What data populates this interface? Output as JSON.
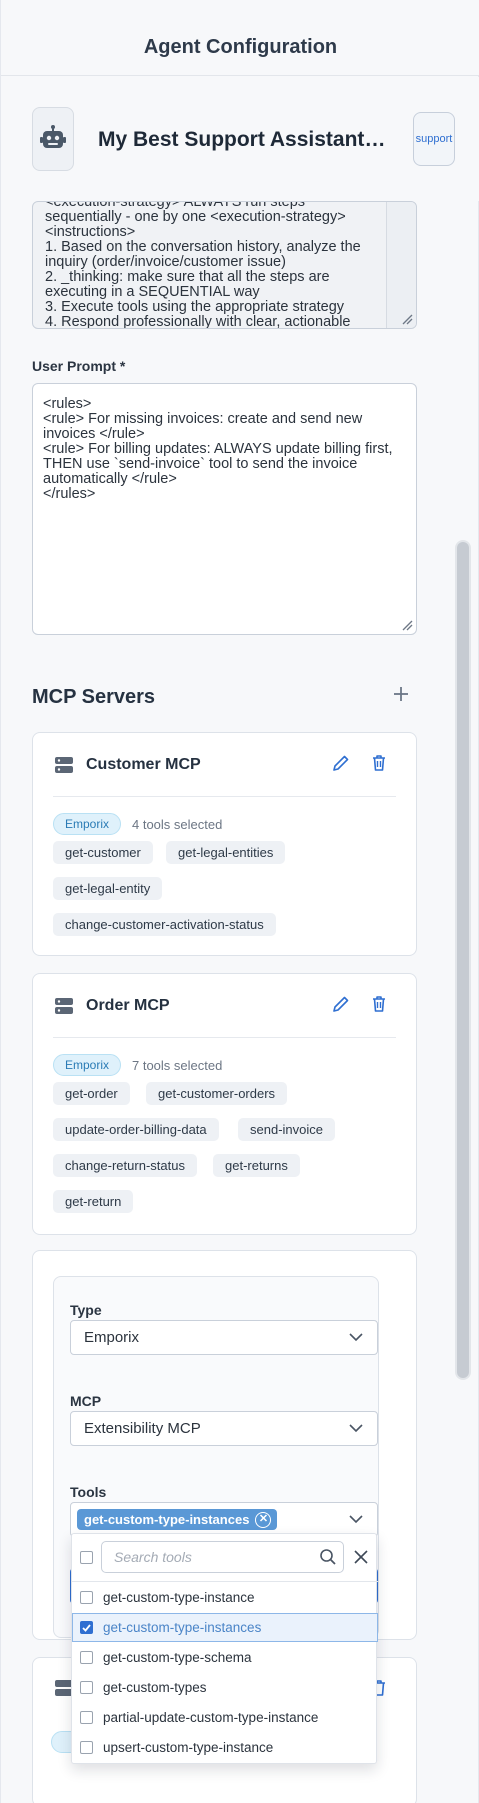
{
  "header": {
    "title": "Agent Configuration"
  },
  "agent": {
    "name": "My Best Support Assistant Co...",
    "support_button": "support",
    "avatar_icon": "robot-icon"
  },
  "system_prompt": {
    "value": "<execution-strategy> ALWAYS run steps sequentially - one by one <execution-strategy>\n<instructions>\n1. Based on the conversation history, analyze the inquiry (order/invoice/customer issue)\n2. _thinking: make sure that all the steps are executing in a SEQUENTIAL way\n3. Execute tools using the appropriate strategy\n4. Respond professionally with clear, actionable"
  },
  "user_prompt": {
    "label": "User Prompt *",
    "value": "<rules>\n<rule> For missing invoices: create and send new invoices </rule>\n<rule> For billing updates: ALWAYS update billing first, THEN use `send-invoice` tool to send the invoice automatically </rule>\n</rules>"
  },
  "mcp_section": {
    "title": "MCP Servers",
    "add_icon": "plus-icon"
  },
  "servers": [
    {
      "name": "Customer MCP",
      "type_badge": "Emporix",
      "tools_count": "4 tools selected",
      "tools": [
        "get-customer",
        "get-legal-entities",
        "get-legal-entity",
        "change-customer-activation-status"
      ]
    },
    {
      "name": "Order MCP",
      "type_badge": "Emporix",
      "tools_count": "7 tools selected",
      "tools": [
        "get-order",
        "get-customer-orders",
        "update-order-billing-data",
        "send-invoice",
        "change-return-status",
        "get-returns",
        "get-return"
      ]
    }
  ],
  "new_server_form": {
    "type_label": "Type",
    "type_value": "Emporix",
    "mcp_label": "MCP",
    "mcp_value": "Extensibility MCP",
    "tools_label": "Tools",
    "selected_tag": "get-custom-type-instances"
  },
  "tools_dropdown": {
    "search_placeholder": "Search tools",
    "options": [
      {
        "label": "get-custom-type-instance",
        "checked": false
      },
      {
        "label": "get-custom-type-instances",
        "checked": true
      },
      {
        "label": "get-custom-type-schema",
        "checked": false
      },
      {
        "label": "get-custom-types",
        "checked": false
      },
      {
        "label": "partial-update-custom-type-instance",
        "checked": false
      },
      {
        "label": "upsert-custom-type-instance",
        "checked": false
      }
    ]
  },
  "colors": {
    "accent": "#2f6fd1",
    "badge_bg": "#dff1fb",
    "chip_bg": "#eef1f5",
    "selected_tag": "#5a98d6"
  }
}
